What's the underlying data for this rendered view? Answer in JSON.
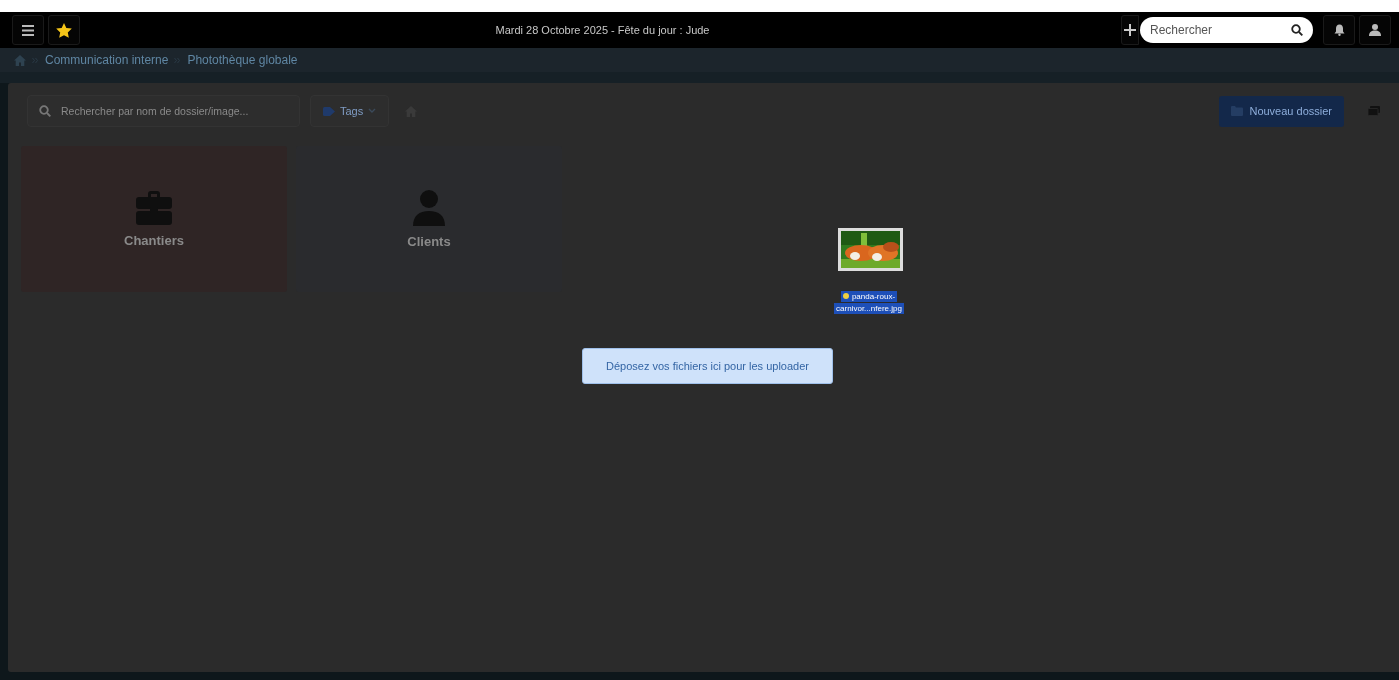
{
  "topbar": {
    "date_text": "Mardi 28 Octobre 2025 - Fête du jour : Jude",
    "search": {
      "placeholder": "Rechercher"
    }
  },
  "breadcrumb": [
    "Communication interne",
    "Photothèque globale"
  ],
  "toolbar": {
    "search": {
      "placeholder": "Rechercher par nom de dossier/image..."
    },
    "tags_label": "Tags",
    "new_folder_label": "Nouveau dossier"
  },
  "folders": [
    {
      "name": "Chantiers",
      "kind": "briefcase",
      "color": "#2f2525"
    },
    {
      "name": "Clients",
      "kind": "person",
      "color": "#2a2b2e"
    }
  ],
  "drag": {
    "file_name": "panda-roux-carnivor...nfere.jpg"
  },
  "drop_hint": "Déposez vos fichiers ici pour les uploader"
}
